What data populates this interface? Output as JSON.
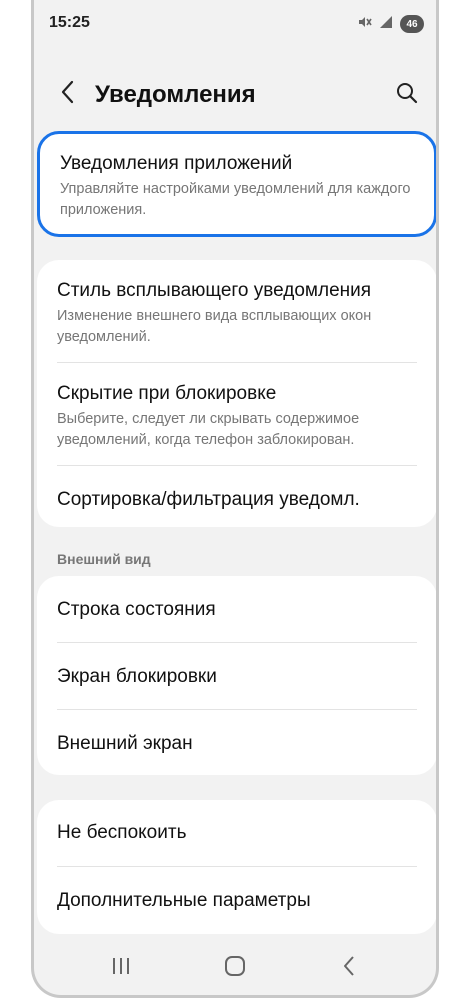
{
  "status_bar": {
    "time": "15:25",
    "battery_level": "46",
    "icons": [
      "mute-icon",
      "signal-icon",
      "battery-icon"
    ]
  },
  "header": {
    "title": "Уведомления",
    "back_icon": "chevron-left-icon",
    "search_icon": "search-icon"
  },
  "highlight_card": {
    "title": "Уведомления приложений",
    "subtitle": "Управляйте настройками уведомлений для каждого приложения."
  },
  "card1": {
    "items": [
      {
        "title": "Стиль всплывающего уведомления",
        "subtitle": "Изменение внешнего вида всплывающих окон уведомлений."
      },
      {
        "title": "Скрытие при блокировке",
        "subtitle": "Выберите, следует ли скрывать содержимое уведомлений, когда телефон заблокирован."
      },
      {
        "title": "Сортировка/фильтрация уведомл."
      }
    ]
  },
  "section_label": "Внешний вид",
  "card2": {
    "items": [
      {
        "title": "Строка состояния"
      },
      {
        "title": "Экран блокировки"
      },
      {
        "title": "Внешний экран"
      }
    ]
  },
  "card3": {
    "items": [
      {
        "title": "Не беспокоить"
      },
      {
        "title": "Дополнительные параметры"
      }
    ]
  },
  "nav_bar": {
    "icons": [
      "recent-apps-icon",
      "home-icon",
      "back-icon"
    ]
  },
  "colors": {
    "accent": "#1a73e8",
    "background": "#f2f2f2",
    "card": "#ffffff"
  }
}
